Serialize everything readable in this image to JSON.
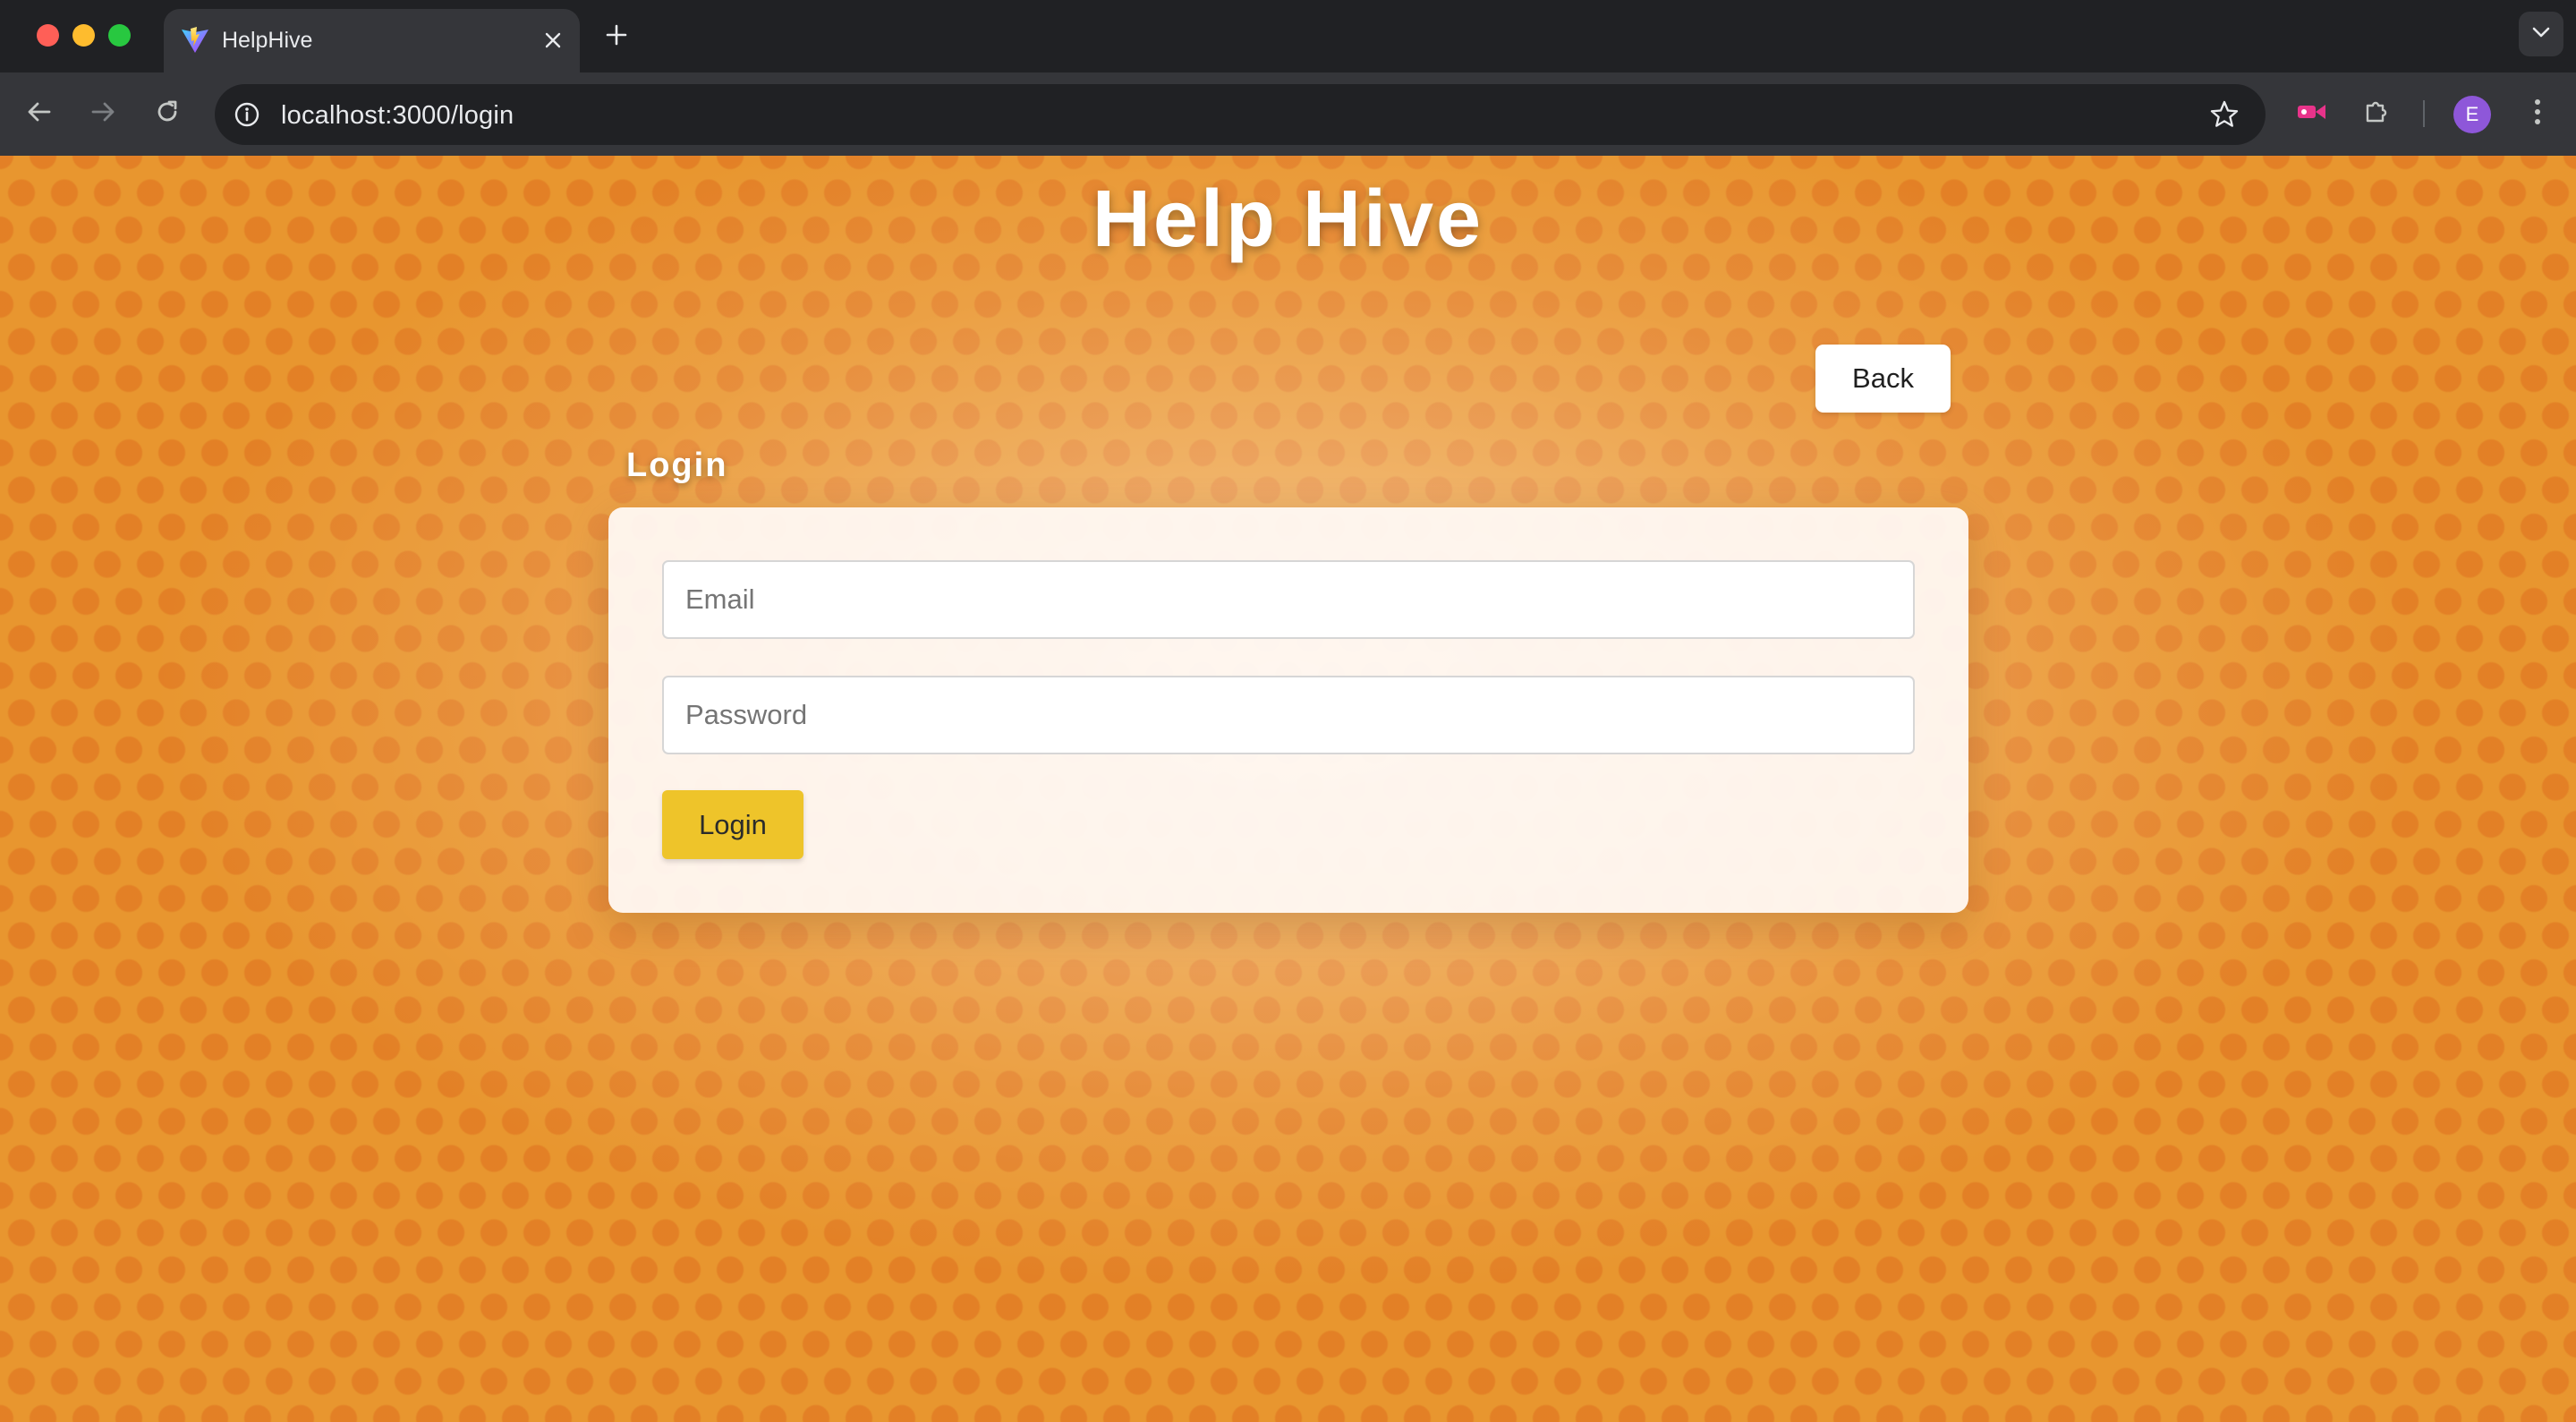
{
  "browser": {
    "tab_title": "HelpHive",
    "url": "localhost:3000/login",
    "profile_initial": "E"
  },
  "page": {
    "title": "Help Hive",
    "back_label": "Back",
    "section_heading": "Login",
    "email_placeholder": "Email",
    "password_placeholder": "Password",
    "login_label": "Login"
  },
  "colors": {
    "accent_button": "#eec42a",
    "page_background": "#e8962f"
  }
}
